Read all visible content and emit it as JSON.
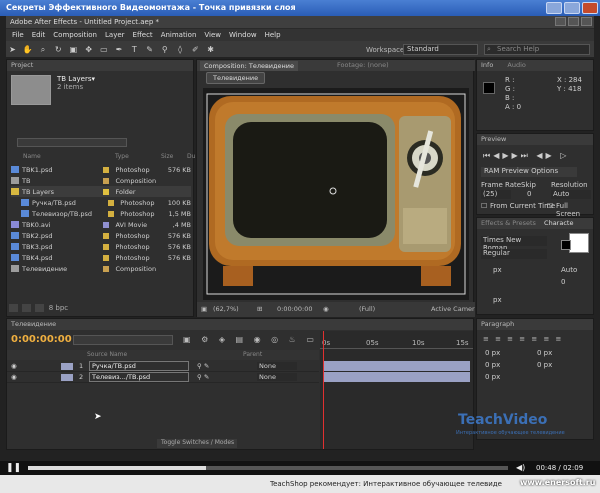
{
  "window": {
    "title": "Секреты Эффективного Видеомонтажа - Точка привязки слоя"
  },
  "app": {
    "title": "Adobe After Effects - Untitled Project.aep *"
  },
  "menu": [
    "File",
    "Edit",
    "Composition",
    "Layer",
    "Effect",
    "Animation",
    "View",
    "Window",
    "Help"
  ],
  "toolbar": {
    "workspace_label": "Workspace:",
    "workspace_value": "Standard",
    "search_placeholder": "Search Help"
  },
  "project": {
    "tab": "Project",
    "selected_name": "TB Layers▾",
    "selected_count": "2 items",
    "columns": {
      "name": "Name",
      "type": "Type",
      "size": "Size",
      "dur": "Du"
    },
    "items": [
      {
        "name": "TBK1.psd",
        "type": "Photoshop",
        "size": "576 KB",
        "tag": "#d4b040",
        "icon": "psd",
        "indent": 0,
        "selected": false
      },
      {
        "name": "TB",
        "type": "Composition",
        "size": "",
        "tag": "#c8a050",
        "icon": "comp",
        "indent": 0,
        "selected": false
      },
      {
        "name": "TB Layers",
        "type": "Folder",
        "size": "",
        "tag": "#e0c040",
        "icon": "folder",
        "indent": 0,
        "selected": true
      },
      {
        "name": "Ручка/TB.psd",
        "type": "Photoshop",
        "size": "100 KB",
        "tag": "#d4b040",
        "icon": "psd",
        "indent": 1,
        "selected": false
      },
      {
        "name": "Телевизор/TB.psd",
        "type": "Photoshop",
        "size": "1,5 MB",
        "tag": "#d4b040",
        "icon": "psd",
        "indent": 1,
        "selected": false
      },
      {
        "name": "TBK0.avi",
        "type": "AVI Movie",
        "size": ",4 MB",
        "tag": "#9090d0",
        "icon": "avi",
        "indent": 0,
        "selected": false
      },
      {
        "name": "TBK2.psd",
        "type": "Photoshop",
        "size": "576 KB",
        "tag": "#d4b040",
        "icon": "psd",
        "indent": 0,
        "selected": false
      },
      {
        "name": "TBK3.psd",
        "type": "Photoshop",
        "size": "576 KB",
        "tag": "#d4b040",
        "icon": "psd",
        "indent": 0,
        "selected": false
      },
      {
        "name": "TBK4.psd",
        "type": "Photoshop",
        "size": "576 KB",
        "tag": "#d4b040",
        "icon": "psd",
        "indent": 0,
        "selected": false
      },
      {
        "name": "Телевидение",
        "type": "Composition",
        "size": "",
        "tag": "#c8a050",
        "icon": "comp",
        "indent": 0,
        "selected": false
      }
    ],
    "footer": "8 bpc"
  },
  "composition": {
    "tab": "Composition: Телевидение",
    "tab2": "Footage: (none)",
    "subtab": "Телевидение",
    "zoom": "(62,7%)",
    "timecode": "0:00:00:00",
    "resolution": "(Full)",
    "camera": "Active Camer"
  },
  "info": {
    "tab": "Info",
    "tab2": "Audio",
    "r": "R :",
    "g": "G :",
    "b": "B :",
    "a": "A : 0",
    "x": "X : 284",
    "y": "Y : 418"
  },
  "preview": {
    "tab": "Preview",
    "ram": "RAM Preview Options",
    "frame_rate_label": "Frame Rate",
    "skip_label": "Skip",
    "resolution_label": "Resolution",
    "frame_rate": "(25)",
    "skip": "0",
    "resolution": "Auto",
    "from_current": "From Current Time",
    "full_screen": "Full Screen"
  },
  "effects": {
    "tab": "Effects & Presets",
    "tab2": "Characte",
    "font": "Times New Roman",
    "style": "Regular",
    "size": "px",
    "auto": "Auto",
    "tracking": "0",
    "px": "px"
  },
  "paragraph": {
    "tab": "Paragraph",
    "v1": "0 px",
    "v2": "0 px",
    "v3": "0 px",
    "v4": "0 px",
    "v5": "0 px"
  },
  "timeline": {
    "tab": "Телевидение",
    "timecode": "0:00:00:00",
    "columns": {
      "source": "Source Name",
      "parent": "Parent"
    },
    "layers": [
      {
        "num": "1",
        "name": "Ручка/TB.psd",
        "parent": "None"
      },
      {
        "num": "2",
        "name": "Телевиз.../TB.psd",
        "parent": "None"
      }
    ],
    "ruler": [
      "0s",
      "05s",
      "10s",
      "15s"
    ],
    "toggle": "Toggle Switches / Modes"
  },
  "watermark": {
    "brand": "TeachVideo",
    "tagline": "Интерактивное обучающее телевидение"
  },
  "player": {
    "time": "00:48 / 02:09",
    "progress": 0.37
  },
  "status": {
    "text": "TeachShop рекомендует: Интерактивное обучающее телевиде",
    "site": "www.enersoft.ru"
  }
}
